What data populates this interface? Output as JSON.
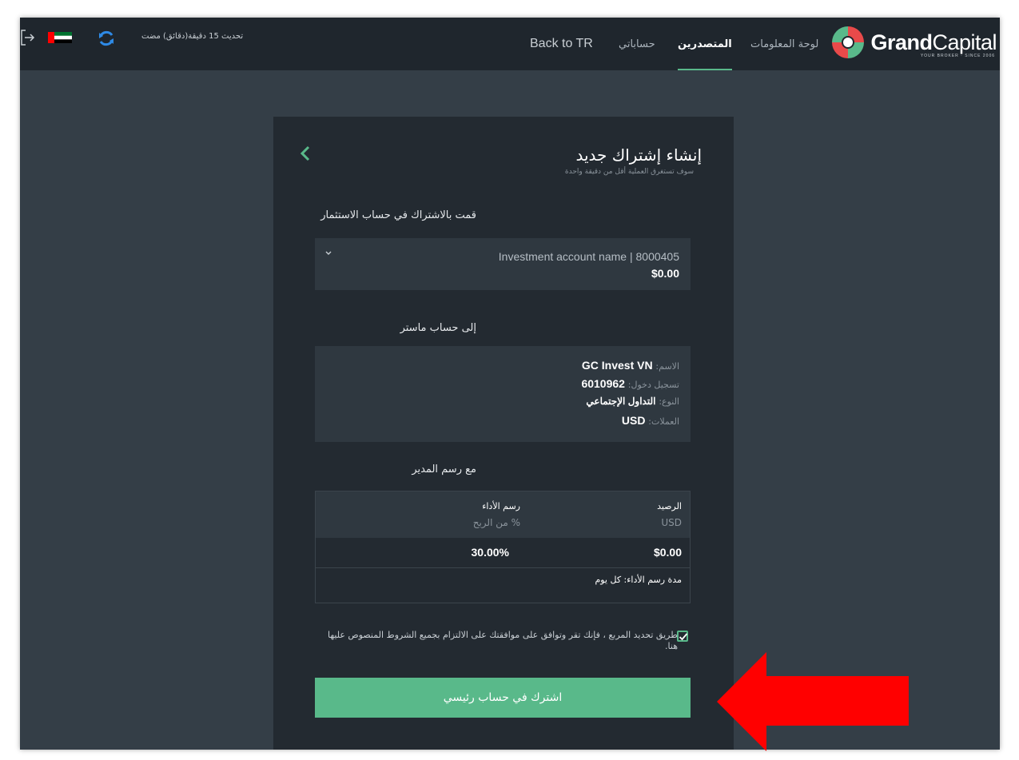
{
  "header": {
    "brand": {
      "bold": "Grand",
      "light": "Capital",
      "tagline": "YOUR BROKER · SINCE 2006"
    },
    "nav": [
      {
        "label": "لوحة المعلومات",
        "active": false
      },
      {
        "label": "المتصدرين",
        "active": true
      },
      {
        "label": "حساباتي",
        "active": false
      },
      {
        "label": "Back to TR",
        "active": false
      }
    ],
    "update_text": "تحديث 15 دقيقة(دقائق) مضت"
  },
  "card": {
    "title": "إنشاء إشتراك جديد",
    "subtitle": "سوف تستغرق العملية أقل من دقيقة واحدة",
    "investment": {
      "label": "قمت بالاشتراك في حساب الاستثمار",
      "account_name": "Investment account name | 8000405",
      "balance": "$0.00"
    },
    "master": {
      "label": "إلى حساب ماستر",
      "rows": [
        {
          "key": "الاسم:",
          "value": "GC Invest VN"
        },
        {
          "key": "تسجيل دخول:",
          "value": "6010962"
        },
        {
          "key": "النوع:",
          "value": "التداول الإجتماعي"
        },
        {
          "key": "العملات:",
          "value": "USD"
        }
      ]
    },
    "fee": {
      "label": "مع رسم المدير",
      "col_balance": "الرصيد",
      "col_balance_sub": "USD",
      "col_perf": "رسم الأداء",
      "col_perf_sub": "% من الربح",
      "balance_value": "$0.00",
      "perf_value": "30.00%",
      "period": "مدة رسم الأداء: كل يوم"
    },
    "terms": "طريق تحديد المربع ، فإنك تقر وتوافق على موافقتك على الالتزام بجميع الشروط المنصوص عليها هنا.",
    "submit_label": "اشترك في حساب رئيسي"
  },
  "colors": {
    "accent": "#59b98a",
    "arrow": "#ff0000",
    "topbar": "#1f262d",
    "panel": "#232a31"
  }
}
